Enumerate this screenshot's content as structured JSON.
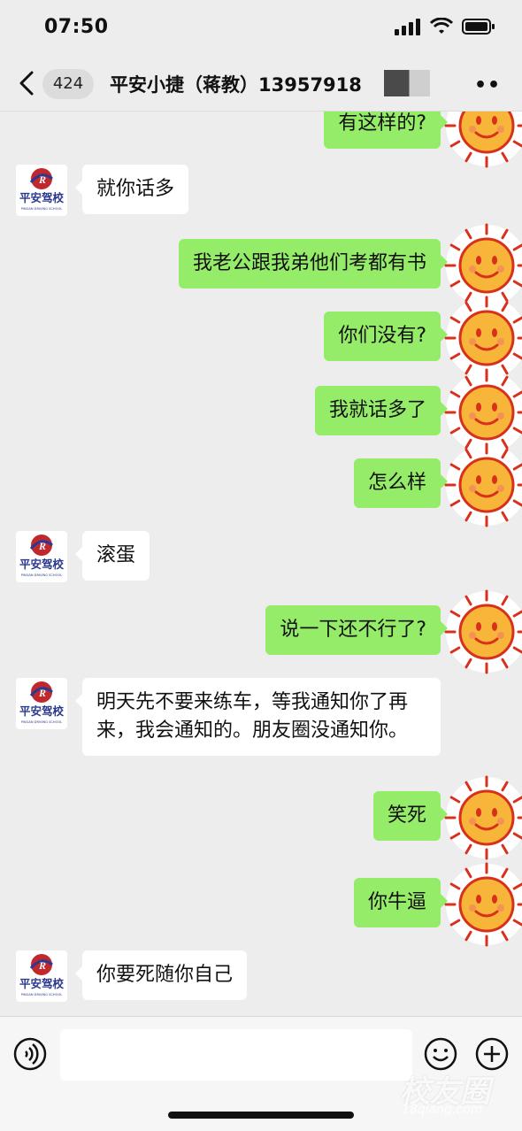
{
  "status_bar": {
    "time": "07:50"
  },
  "nav": {
    "unread_count": "424",
    "title": "平安小捷（蒋教）1395791",
    "title_tail": "8"
  },
  "contact_avatar": {
    "brand": "平安驾校",
    "brand_en": "PINGAN DRIVING SCHOOL",
    "accent": "#c0282d",
    "brand_color": "#2b3a8f"
  },
  "messages": [
    {
      "side": "out",
      "text": "有这样的?"
    },
    {
      "side": "in",
      "text": "就你话多"
    },
    {
      "side": "out",
      "text": "我老公跟我弟他们考都有书"
    },
    {
      "side": "out",
      "text": "你们没有?"
    },
    {
      "side": "out",
      "text": "我就话多了"
    },
    {
      "side": "out",
      "text": "怎么样"
    },
    {
      "side": "in",
      "text": "滚蛋"
    },
    {
      "side": "out",
      "text": "说一下还不行了?"
    },
    {
      "side": "in",
      "text": "明天先不要来练车，等我通知你了再来，我会通知的。朋友圈没通知你。"
    },
    {
      "side": "out",
      "text": "笑死"
    },
    {
      "side": "out",
      "text": "你牛逼"
    },
    {
      "side": "in",
      "text": "你要死随你自己"
    }
  ],
  "watermark": {
    "text": "校友圈",
    "sub": "18qiang.com"
  },
  "colors": {
    "outgoing_bubble": "#95ec69",
    "incoming_bubble": "#ffffff",
    "background": "#ededed"
  }
}
